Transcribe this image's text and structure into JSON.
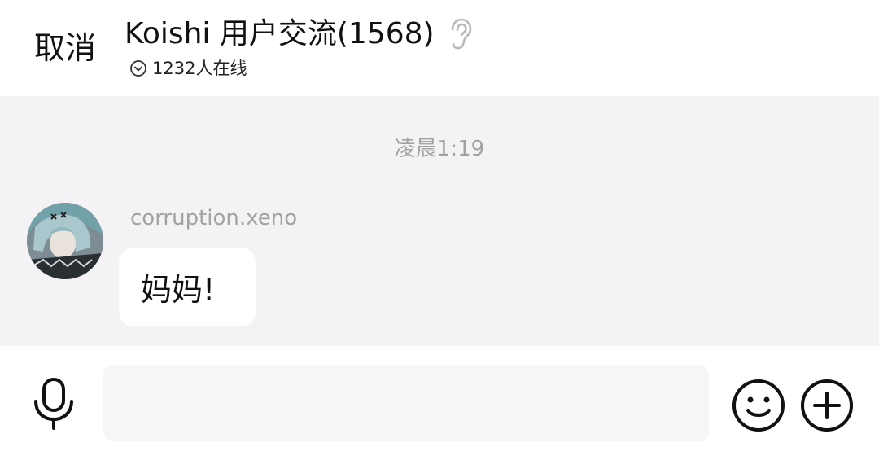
{
  "header": {
    "cancel_label": "取消",
    "title": "Koishi 用户交流(1568)",
    "title_icon": "ear-icon",
    "online_icon": "chevron-circle-down-icon",
    "online_text": "1232人在线"
  },
  "chat": {
    "background_color": "#f4f2f4",
    "timestamp": "凌晨1:19",
    "messages": [
      {
        "sender": "corruption.xeno",
        "text": "妈妈!",
        "avatar": "anime-avatar"
      }
    ]
  },
  "input_bar": {
    "voice_icon": "microphone-icon",
    "message_placeholder": "",
    "emoji_icon": "smiley-icon",
    "more_icon": "plus-circle-icon"
  }
}
